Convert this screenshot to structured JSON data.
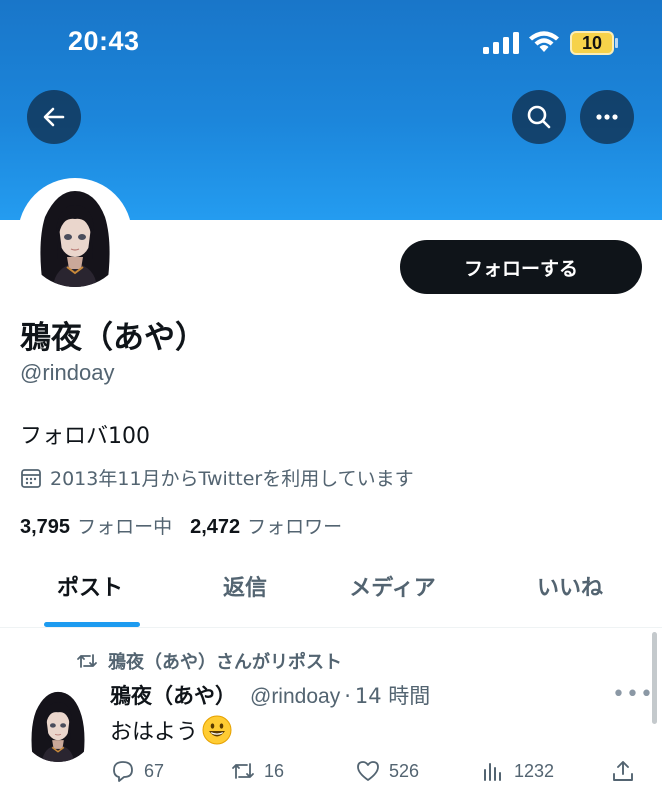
{
  "status_bar": {
    "time": "20:43",
    "battery": "10",
    "battery_color": "#f6d24a"
  },
  "banner": {
    "color": "#1d8de2"
  },
  "toolbar": {
    "back_icon": "arrow-left-icon",
    "search_icon": "search-icon",
    "more_icon": "more-horizontal-icon"
  },
  "profile": {
    "display_name": "鴉夜（あや）",
    "handle": "@rindoay",
    "bio": "フォロバ100",
    "joined": "2013年11月からTwitterを利用しています",
    "following_count": "3,795",
    "following_label": "フォロー中",
    "followers_count": "2,472",
    "followers_label": "フォロワー",
    "follow_button": "フォローする"
  },
  "tabs": [
    {
      "label": "ポスト",
      "active": true
    },
    {
      "label": "返信",
      "active": false
    },
    {
      "label": "メディア",
      "active": false
    },
    {
      "label": "いいね",
      "active": false
    }
  ],
  "tweet": {
    "repost_label": "鴉夜（あや）さんがリポスト",
    "name": "鴉夜（あや）",
    "handle": "@rindoay",
    "dot": "·",
    "time": "14 時間",
    "text": "おはよう",
    "emoji": "grinning-face-emoji",
    "replies": "67",
    "reposts": "16",
    "likes": "526",
    "views": "1232"
  },
  "colors": {
    "accent": "#1d9bf0",
    "text_primary": "#0f1419",
    "text_secondary": "#536471"
  }
}
